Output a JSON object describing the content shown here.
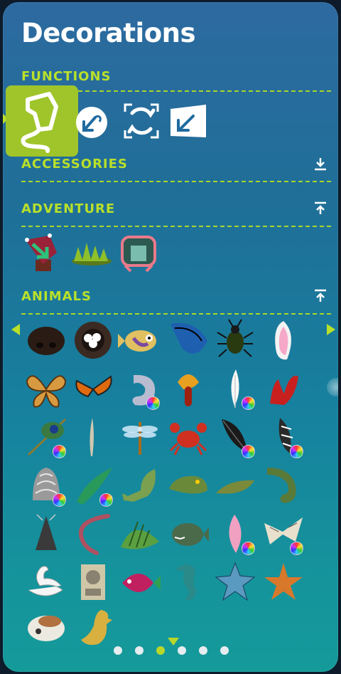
{
  "panel": {
    "title": "Decorations"
  },
  "sections": {
    "functions": {
      "label": "FUNCTIONS"
    },
    "accessories": {
      "label": "ACCESSORIES",
      "toggle_icon": "expand-down-icon"
    },
    "adventure": {
      "label": "ADVENTURE",
      "toggle_icon": "collapse-up-icon"
    },
    "animals": {
      "label": "ANIMALS",
      "toggle_icon": "collapse-up-icon"
    }
  },
  "functions": [
    {
      "icon": "rope-tool-icon",
      "selected": true
    },
    {
      "icon": "rotate-arrow-icon"
    },
    {
      "icon": "resize-frame-icon"
    },
    {
      "icon": "flip-arrow-icon"
    }
  ],
  "adventure_items": [
    "arrow-sign-icon",
    "grass-tuft-icon",
    "ornate-gate-icon"
  ],
  "animal_items": [
    "nose-icon",
    "nest-eggs-icon",
    "fish-icon",
    "blue-wing-icon",
    "beetle-icon",
    "bunny-ear-icon",
    "butterfly-icon",
    "monarch-butterfly-icon",
    "curled-tail-icon",
    "mushroom-icon",
    "white-feather-icon",
    "coral-icon",
    "peacock-feather-icon",
    "quill-icon",
    "dragonfly-icon",
    "crab-icon",
    "black-feather-icon",
    "striped-feather-icon",
    "scale-tail-icon",
    "green-horn-icon",
    "lizard-leg-icon",
    "crocodile-head-icon",
    "crocodile-snout-icon",
    "tentacle-icon",
    "bell-icon",
    "worm-icon",
    "fin-icon",
    "piranha-icon",
    "pink-feather-icon",
    "paper-wing-icon",
    "swan-icon",
    "statue-icon",
    "tropical-fish-icon",
    "seahorse-icon",
    "blue-starfish-icon",
    "orange-starfish-icon",
    "spotted-skull-icon",
    "yellow-duck-icon"
  ],
  "color_variants": [
    "curled-tail-icon",
    "white-feather-icon",
    "peacock-feather-icon",
    "black-feather-icon",
    "striped-feather-icon",
    "scale-tail-icon",
    "green-horn-icon",
    "pink-feather-icon",
    "paper-wing-icon"
  ],
  "pager": {
    "pages": 6,
    "current": 3
  },
  "colors": {
    "accent": "#b9e02a",
    "panel_top": "#2d6aa0",
    "panel_bottom": "#159a9a"
  }
}
